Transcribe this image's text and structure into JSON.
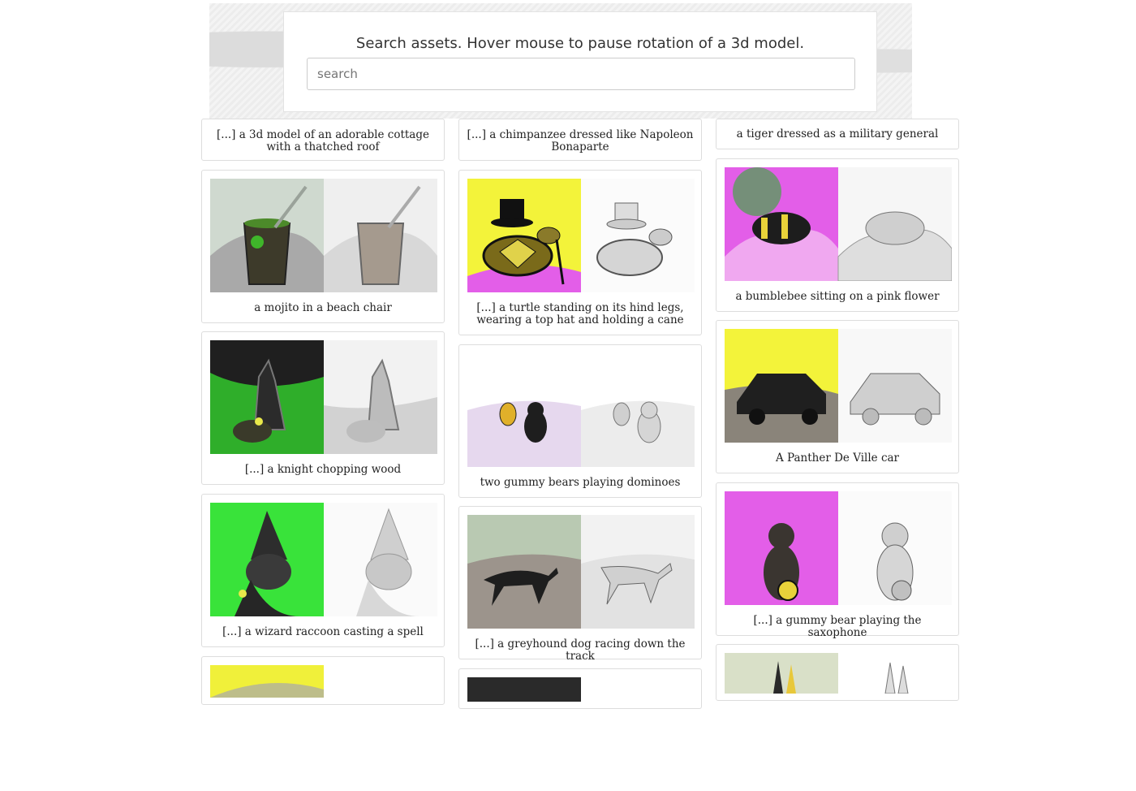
{
  "search": {
    "title": "Search assets. Hover mouse to pause rotation of a 3d model.",
    "placeholder": "search"
  },
  "columns": [
    {
      "items": [
        {
          "caption": "[...] a 3d model of an adorable cottage with a thatched roof",
          "colored_bg": "#ffffff",
          "subject": "cottage-icon"
        },
        {
          "caption": "a mojito in a beach chair",
          "colored_bg": "#cfd9cf",
          "subject": "glass-icon"
        },
        {
          "caption": "[...] a knight chopping wood",
          "colored_bg": "#2a2a2a",
          "subject": "knight-icon"
        },
        {
          "caption": "[...] a wizard raccoon casting a spell",
          "colored_bg": "#39e33a",
          "subject": "raccoon-icon"
        },
        {
          "caption": "",
          "colored_bg": "#f0f03a",
          "subject": "partial-icon"
        }
      ]
    },
    {
      "items": [
        {
          "caption": "[...] a chimpanzee dressed like Napoleon Bonaparte",
          "colored_bg": "#ffffff",
          "subject": "chimp-icon"
        },
        {
          "caption": "[...] a turtle standing on its hind legs, wearing a top hat and holding a cane",
          "colored_bg": "#f3f33a",
          "subject": "turtle-icon"
        },
        {
          "caption": "two gummy bears playing dominoes",
          "colored_bg": "#e8dff0",
          "subject": "gummy-bears-icon"
        },
        {
          "caption": "[...] a greyhound dog racing down the track",
          "colored_bg": "#b9c9b2",
          "subject": "greyhound-icon"
        },
        {
          "caption": "",
          "colored_bg": "#2a2a2a",
          "subject": "partial-icon"
        }
      ]
    },
    {
      "items": [
        {
          "caption": "a tiger dressed as a military general",
          "colored_bg": "#ffffff",
          "subject": "tiger-icon"
        },
        {
          "caption": "a bumblebee sitting on a pink flower",
          "colored_bg": "#e35ee8",
          "subject": "bee-icon"
        },
        {
          "caption": "A Panther De Ville car",
          "colored_bg": "#f3f33a",
          "subject": "car-icon"
        },
        {
          "caption": "[...] a gummy bear playing the saxophone",
          "colored_bg": "#e35ee8",
          "subject": "sax-bear-icon"
        },
        {
          "caption": "",
          "colored_bg": "#d9e0c8",
          "subject": "rabbit-icon"
        }
      ]
    }
  ]
}
